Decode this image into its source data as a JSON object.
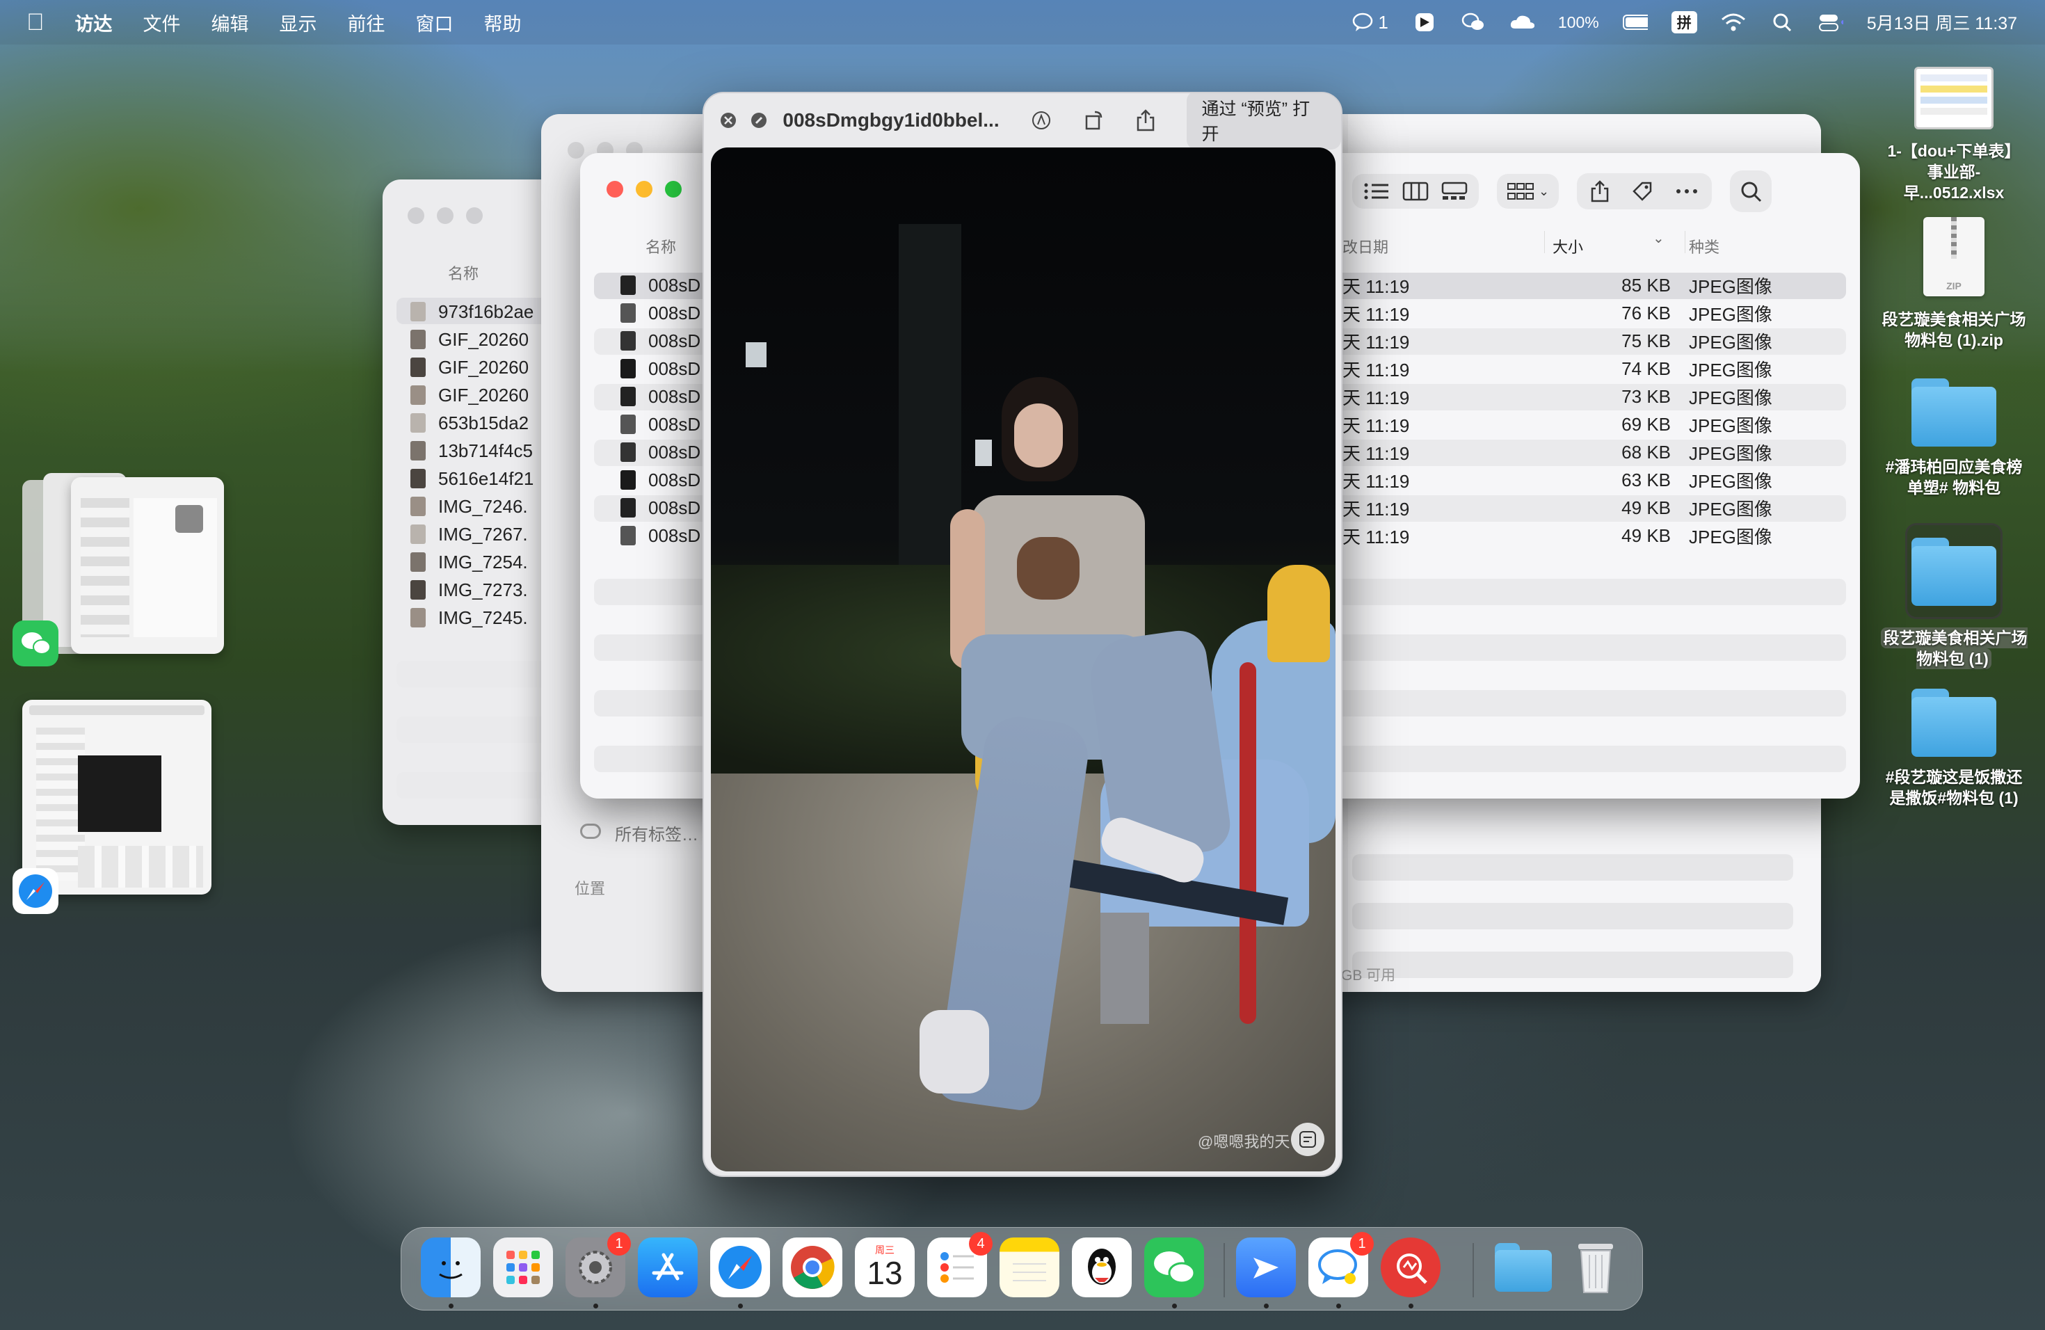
{
  "menubar": {
    "app": "访达",
    "items": [
      "文件",
      "编辑",
      "显示",
      "前往",
      "窗口",
      "帮助"
    ],
    "status": {
      "chat_count": "1",
      "battery": "100%",
      "input": "拼",
      "datetime": "5月13日 周三  11:37"
    }
  },
  "back_finder": {
    "col_name": "名称",
    "files": [
      "973f16b2ae",
      "GIF_20260",
      "GIF_20260",
      "GIF_20260",
      "653b15da2",
      "13b714f4c5",
      "5616e14f21",
      "IMG_7246.",
      "IMG_7267.",
      "IMG_7254.",
      "IMG_7273.",
      "IMG_7245."
    ]
  },
  "middle_finder": {
    "sidebar_tags": "所有标签…",
    "sidebar_location": "位置",
    "storage": "GB 可用"
  },
  "front_finder": {
    "col_name": "名称",
    "col_date": "改日期",
    "col_size": "大小",
    "col_kind": "种类",
    "rows": [
      {
        "name": "008sD",
        "date": "天 11:19",
        "size": "85 KB",
        "kind": "JPEG图像"
      },
      {
        "name": "008sD",
        "date": "天 11:19",
        "size": "76 KB",
        "kind": "JPEG图像"
      },
      {
        "name": "008sD",
        "date": "天 11:19",
        "size": "75 KB",
        "kind": "JPEG图像"
      },
      {
        "name": "008sD",
        "date": "天 11:19",
        "size": "74 KB",
        "kind": "JPEG图像"
      },
      {
        "name": "008sD",
        "date": "天 11:19",
        "size": "73 KB",
        "kind": "JPEG图像"
      },
      {
        "name": "008sD",
        "date": "天 11:19",
        "size": "69 KB",
        "kind": "JPEG图像"
      },
      {
        "name": "008sD",
        "date": "天 11:19",
        "size": "68 KB",
        "kind": "JPEG图像"
      },
      {
        "name": "008sD",
        "date": "天 11:19",
        "size": "63 KB",
        "kind": "JPEG图像"
      },
      {
        "name": "008sD",
        "date": "天 11:19",
        "size": "49 KB",
        "kind": "JPEG图像"
      },
      {
        "name": "008sD",
        "date": "天 11:19",
        "size": "49 KB",
        "kind": "JPEG图像"
      }
    ]
  },
  "quicklook": {
    "title": "008sDmgbgy1id0bbel...",
    "open_button": "通过 “预览” 打开",
    "watermark": "@嗯嗯我的天"
  },
  "desktop_icons": [
    {
      "label": "1-【dou+下单表】事业部-早...0512.xlsx",
      "type": "xlsx"
    },
    {
      "label": "段艺璇美食相关广场物料包 (1).zip",
      "type": "zip"
    },
    {
      "label": "#潘玮柏回应美食榜单塑# 物料包",
      "type": "folder"
    },
    {
      "label": "段艺璇美食相关广场物料包 (1)",
      "type": "folder"
    },
    {
      "label": "#段艺璇这是饭撒还是撒饭#物料包 (1)",
      "type": "folder"
    }
  ],
  "dock": {
    "apps": [
      "finder-icon",
      "launchpad-icon",
      "system-settings-icon",
      "app-store-icon",
      "safari-icon",
      "chrome-icon",
      "calendar-icon",
      "reminders-icon",
      "notes-icon",
      "qq-icon",
      "wechat-icon",
      "feishu-icon",
      "messages-icon",
      "vpn-icon",
      "folder-icon",
      "trash-icon"
    ],
    "calendar_day": "13",
    "calendar_weekday": "周三",
    "badges": {
      "settings": "1",
      "reminders": "4",
      "messages": "1"
    }
  }
}
